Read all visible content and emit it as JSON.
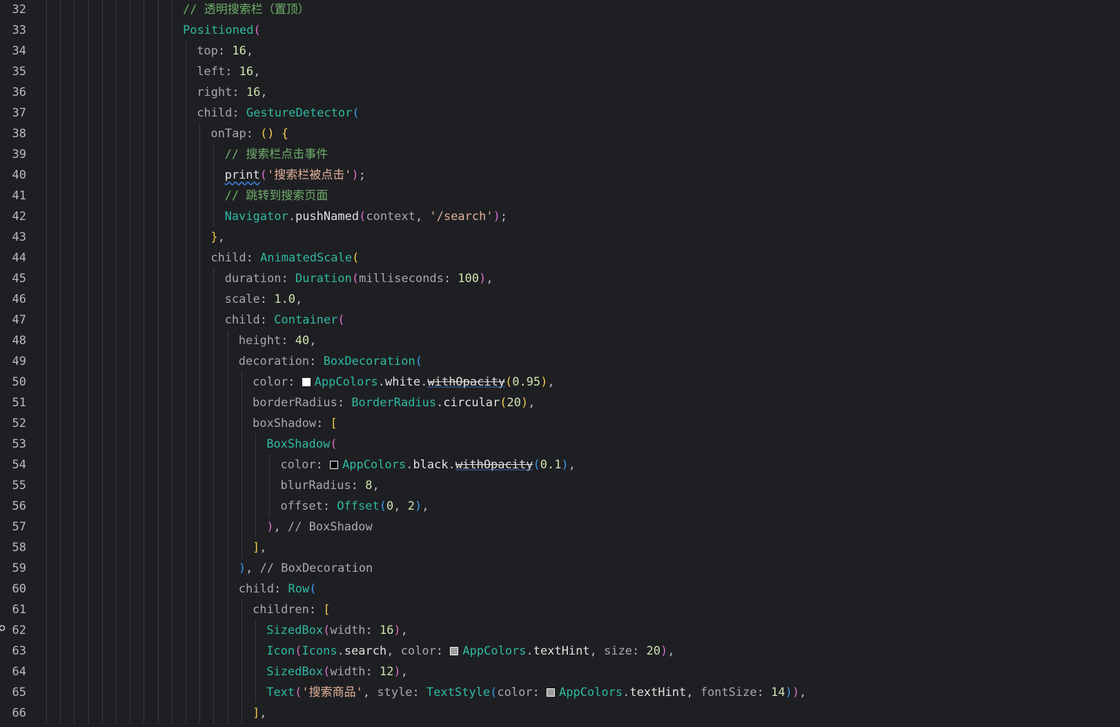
{
  "editor": {
    "language": "dart",
    "colors": {
      "background": "#1e1f22",
      "line_number": "#b9bcc2",
      "class": "#2fbaa3",
      "comment": "#6fae6b",
      "string": "#e3b09a",
      "number": "#cfe3b0",
      "swatch_white": "#ffffff",
      "swatch_black": "#000000",
      "swatch_hint": "#9e9e9e"
    },
    "gutter_icon": "search-usage-icon",
    "lines": [
      {
        "n": "32",
        "indent": 10,
        "tokens": [
          {
            "t": "// 透明搜索栏（置顶）",
            "c": "comment"
          }
        ]
      },
      {
        "n": "33",
        "indent": 10,
        "tokens": [
          {
            "t": "Positioned",
            "c": "cls"
          },
          {
            "t": "(",
            "c": "b2"
          }
        ]
      },
      {
        "n": "34",
        "indent": 11,
        "tokens": [
          {
            "t": "top",
            "c": "param"
          },
          {
            "t": ": ",
            "c": "punct"
          },
          {
            "t": "16",
            "c": "num"
          },
          {
            "t": ",",
            "c": "punct"
          }
        ]
      },
      {
        "n": "35",
        "indent": 11,
        "tokens": [
          {
            "t": "left",
            "c": "param"
          },
          {
            "t": ": ",
            "c": "punct"
          },
          {
            "t": "16",
            "c": "num"
          },
          {
            "t": ",",
            "c": "punct"
          }
        ]
      },
      {
        "n": "36",
        "indent": 11,
        "tokens": [
          {
            "t": "right",
            "c": "param"
          },
          {
            "t": ": ",
            "c": "punct"
          },
          {
            "t": "16",
            "c": "num"
          },
          {
            "t": ",",
            "c": "punct"
          }
        ]
      },
      {
        "n": "37",
        "indent": 11,
        "tokens": [
          {
            "t": "child",
            "c": "param"
          },
          {
            "t": ": ",
            "c": "punct"
          },
          {
            "t": "GestureDetector",
            "c": "cls"
          },
          {
            "t": "(",
            "c": "b3"
          }
        ]
      },
      {
        "n": "38",
        "indent": 12,
        "tokens": [
          {
            "t": "onTap",
            "c": "param"
          },
          {
            "t": ": ",
            "c": "punct"
          },
          {
            "t": "()",
            "c": "b1"
          },
          {
            "t": " ",
            "c": "punct"
          },
          {
            "t": "{",
            "c": "b1"
          }
        ]
      },
      {
        "n": "39",
        "indent": 13,
        "tokens": [
          {
            "t": "// 搜索栏点击事件",
            "c": "comment"
          }
        ]
      },
      {
        "n": "40",
        "indent": 13,
        "tokens": [
          {
            "t": "print",
            "c": "fn",
            "deco": "wavy"
          },
          {
            "t": "(",
            "c": "b2"
          },
          {
            "t": "'搜索栏被点击'",
            "c": "str"
          },
          {
            "t": ")",
            "c": "b2"
          },
          {
            "t": ";",
            "c": "punct"
          }
        ]
      },
      {
        "n": "41",
        "indent": 13,
        "tokens": [
          {
            "t": "// 跳转到搜索页面",
            "c": "comment"
          }
        ]
      },
      {
        "n": "42",
        "indent": 13,
        "tokens": [
          {
            "t": "Navigator",
            "c": "cls"
          },
          {
            "t": ".",
            "c": "punct"
          },
          {
            "t": "pushNamed",
            "c": "fn"
          },
          {
            "t": "(",
            "c": "b2"
          },
          {
            "t": "context",
            "c": "param"
          },
          {
            "t": ", ",
            "c": "punct"
          },
          {
            "t": "'/search'",
            "c": "str"
          },
          {
            "t": ")",
            "c": "b2"
          },
          {
            "t": ";",
            "c": "punct"
          }
        ]
      },
      {
        "n": "43",
        "indent": 12,
        "tokens": [
          {
            "t": "}",
            "c": "b1"
          },
          {
            "t": ",",
            "c": "punct"
          }
        ]
      },
      {
        "n": "44",
        "indent": 12,
        "tokens": [
          {
            "t": "child",
            "c": "param"
          },
          {
            "t": ": ",
            "c": "punct"
          },
          {
            "t": "AnimatedScale",
            "c": "cls"
          },
          {
            "t": "(",
            "c": "b1"
          }
        ]
      },
      {
        "n": "45",
        "indent": 13,
        "tokens": [
          {
            "t": "duration",
            "c": "param"
          },
          {
            "t": ": ",
            "c": "punct"
          },
          {
            "t": "Duration",
            "c": "cls"
          },
          {
            "t": "(",
            "c": "b2"
          },
          {
            "t": "milliseconds",
            "c": "param"
          },
          {
            "t": ": ",
            "c": "punct"
          },
          {
            "t": "100",
            "c": "num"
          },
          {
            "t": ")",
            "c": "b2"
          },
          {
            "t": ",",
            "c": "punct"
          }
        ]
      },
      {
        "n": "46",
        "indent": 13,
        "tokens": [
          {
            "t": "scale",
            "c": "param"
          },
          {
            "t": ": ",
            "c": "punct"
          },
          {
            "t": "1.0",
            "c": "num"
          },
          {
            "t": ",",
            "c": "punct"
          }
        ]
      },
      {
        "n": "47",
        "indent": 13,
        "tokens": [
          {
            "t": "child",
            "c": "param"
          },
          {
            "t": ": ",
            "c": "punct"
          },
          {
            "t": "Container",
            "c": "cls"
          },
          {
            "t": "(",
            "c": "b2"
          }
        ]
      },
      {
        "n": "48",
        "indent": 14,
        "tokens": [
          {
            "t": "height",
            "c": "param"
          },
          {
            "t": ": ",
            "c": "punct"
          },
          {
            "t": "40",
            "c": "num"
          },
          {
            "t": ",",
            "c": "punct"
          }
        ]
      },
      {
        "n": "49",
        "indent": 14,
        "tokens": [
          {
            "t": "decoration",
            "c": "param"
          },
          {
            "t": ": ",
            "c": "punct"
          },
          {
            "t": "BoxDecoration",
            "c": "cls"
          },
          {
            "t": "(",
            "c": "b3"
          }
        ]
      },
      {
        "n": "50",
        "indent": 15,
        "tokens": [
          {
            "t": "color",
            "c": "param"
          },
          {
            "t": ": ",
            "c": "punct"
          },
          {
            "swatch": "#ffffff"
          },
          {
            "t": "AppColors",
            "c": "cls"
          },
          {
            "t": ".",
            "c": "punct"
          },
          {
            "t": "white",
            "c": "fn"
          },
          {
            "t": ".",
            "c": "punct"
          },
          {
            "t": "withOpacity",
            "c": "fn",
            "deco": "strike-wavy"
          },
          {
            "t": "(",
            "c": "b1"
          },
          {
            "t": "0.95",
            "c": "num"
          },
          {
            "t": ")",
            "c": "b1"
          },
          {
            "t": ",",
            "c": "punct"
          }
        ]
      },
      {
        "n": "51",
        "indent": 15,
        "tokens": [
          {
            "t": "borderRadius",
            "c": "param"
          },
          {
            "t": ": ",
            "c": "punct"
          },
          {
            "t": "BorderRadius",
            "c": "cls"
          },
          {
            "t": ".",
            "c": "punct"
          },
          {
            "t": "circular",
            "c": "fn"
          },
          {
            "t": "(",
            "c": "b1"
          },
          {
            "t": "20",
            "c": "num"
          },
          {
            "t": ")",
            "c": "b1"
          },
          {
            "t": ",",
            "c": "punct"
          }
        ]
      },
      {
        "n": "52",
        "indent": 15,
        "tokens": [
          {
            "t": "boxShadow",
            "c": "param"
          },
          {
            "t": ": ",
            "c": "punct"
          },
          {
            "t": "[",
            "c": "b1"
          }
        ]
      },
      {
        "n": "53",
        "indent": 16,
        "tokens": [
          {
            "t": "BoxShadow",
            "c": "cls"
          },
          {
            "t": "(",
            "c": "b2"
          }
        ]
      },
      {
        "n": "54",
        "indent": 17,
        "tokens": [
          {
            "t": "color",
            "c": "param"
          },
          {
            "t": ": ",
            "c": "punct"
          },
          {
            "swatch": "#000000"
          },
          {
            "t": "AppColors",
            "c": "cls"
          },
          {
            "t": ".",
            "c": "punct"
          },
          {
            "t": "black",
            "c": "fn"
          },
          {
            "t": ".",
            "c": "punct"
          },
          {
            "t": "withOpacity",
            "c": "fn",
            "deco": "strike-wavy"
          },
          {
            "t": "(",
            "c": "b3"
          },
          {
            "t": "0.1",
            "c": "num"
          },
          {
            "t": ")",
            "c": "b3"
          },
          {
            "t": ",",
            "c": "punct"
          }
        ]
      },
      {
        "n": "55",
        "indent": 17,
        "tokens": [
          {
            "t": "blurRadius",
            "c": "param"
          },
          {
            "t": ": ",
            "c": "punct"
          },
          {
            "t": "8",
            "c": "num"
          },
          {
            "t": ",",
            "c": "punct"
          }
        ]
      },
      {
        "n": "56",
        "indent": 17,
        "tokens": [
          {
            "t": "offset",
            "c": "param"
          },
          {
            "t": ": ",
            "c": "punct"
          },
          {
            "t": "Offset",
            "c": "cls"
          },
          {
            "t": "(",
            "c": "b3"
          },
          {
            "t": "0",
            "c": "num"
          },
          {
            "t": ", ",
            "c": "punct"
          },
          {
            "t": "2",
            "c": "num"
          },
          {
            "t": ")",
            "c": "b3"
          },
          {
            "t": ",",
            "c": "punct"
          }
        ]
      },
      {
        "n": "57",
        "indent": 16,
        "tokens": [
          {
            "t": ")",
            "c": "b2"
          },
          {
            "t": ", ",
            "c": "punct"
          },
          {
            "t": "// BoxShadow",
            "c": "comment-plain"
          }
        ]
      },
      {
        "n": "58",
        "indent": 15,
        "tokens": [
          {
            "t": "]",
            "c": "b1"
          },
          {
            "t": ",",
            "c": "punct"
          }
        ]
      },
      {
        "n": "59",
        "indent": 14,
        "tokens": [
          {
            "t": ")",
            "c": "b3"
          },
          {
            "t": ", ",
            "c": "punct"
          },
          {
            "t": "// BoxDecoration",
            "c": "comment-plain"
          }
        ]
      },
      {
        "n": "60",
        "indent": 14,
        "tokens": [
          {
            "t": "child",
            "c": "param"
          },
          {
            "t": ": ",
            "c": "punct"
          },
          {
            "t": "Row",
            "c": "cls"
          },
          {
            "t": "(",
            "c": "b3"
          }
        ]
      },
      {
        "n": "61",
        "indent": 15,
        "tokens": [
          {
            "t": "children",
            "c": "param"
          },
          {
            "t": ": ",
            "c": "punct"
          },
          {
            "t": "[",
            "c": "b1"
          }
        ]
      },
      {
        "n": "62",
        "indent": 16,
        "tokens": [
          {
            "t": "SizedBox",
            "c": "cls"
          },
          {
            "t": "(",
            "c": "b2"
          },
          {
            "t": "width",
            "c": "param"
          },
          {
            "t": ": ",
            "c": "punct"
          },
          {
            "t": "16",
            "c": "num"
          },
          {
            "t": ")",
            "c": "b2"
          },
          {
            "t": ",",
            "c": "punct"
          }
        ]
      },
      {
        "n": "63",
        "indent": 16,
        "tokens": [
          {
            "t": "Icon",
            "c": "cls"
          },
          {
            "t": "(",
            "c": "b2"
          },
          {
            "t": "Icons",
            "c": "cls"
          },
          {
            "t": ".",
            "c": "punct"
          },
          {
            "t": "search",
            "c": "fn"
          },
          {
            "t": ", ",
            "c": "punct"
          },
          {
            "t": "color",
            "c": "param"
          },
          {
            "t": ": ",
            "c": "punct"
          },
          {
            "swatch": "#9e9e9e"
          },
          {
            "t": "AppColors",
            "c": "cls"
          },
          {
            "t": ".",
            "c": "punct"
          },
          {
            "t": "textHint",
            "c": "fn"
          },
          {
            "t": ", ",
            "c": "punct"
          },
          {
            "t": "size",
            "c": "param"
          },
          {
            "t": ": ",
            "c": "punct"
          },
          {
            "t": "20",
            "c": "num"
          },
          {
            "t": ")",
            "c": "b2"
          },
          {
            "t": ",",
            "c": "punct"
          }
        ]
      },
      {
        "n": "64",
        "indent": 16,
        "tokens": [
          {
            "t": "SizedBox",
            "c": "cls"
          },
          {
            "t": "(",
            "c": "b2"
          },
          {
            "t": "width",
            "c": "param"
          },
          {
            "t": ": ",
            "c": "punct"
          },
          {
            "t": "12",
            "c": "num"
          },
          {
            "t": ")",
            "c": "b2"
          },
          {
            "t": ",",
            "c": "punct"
          }
        ]
      },
      {
        "n": "65",
        "indent": 16,
        "tokens": [
          {
            "t": "Text",
            "c": "cls"
          },
          {
            "t": "(",
            "c": "b2"
          },
          {
            "t": "'搜索商品'",
            "c": "str"
          },
          {
            "t": ", ",
            "c": "punct"
          },
          {
            "t": "style",
            "c": "param"
          },
          {
            "t": ": ",
            "c": "punct"
          },
          {
            "t": "TextStyle",
            "c": "cls"
          },
          {
            "t": "(",
            "c": "b3"
          },
          {
            "t": "color",
            "c": "param"
          },
          {
            "t": ": ",
            "c": "punct"
          },
          {
            "swatch": "#9e9e9e"
          },
          {
            "t": "AppColors",
            "c": "cls"
          },
          {
            "t": ".",
            "c": "punct"
          },
          {
            "t": "textHint",
            "c": "fn"
          },
          {
            "t": ", ",
            "c": "punct"
          },
          {
            "t": "fontSize",
            "c": "param"
          },
          {
            "t": ": ",
            "c": "punct"
          },
          {
            "t": "14",
            "c": "num"
          },
          {
            "t": ")",
            "c": "b3"
          },
          {
            "t": ")",
            "c": "b2"
          },
          {
            "t": ",",
            "c": "punct"
          }
        ]
      },
      {
        "n": "66",
        "indent": 15,
        "tokens": [
          {
            "t": "]",
            "c": "b1"
          },
          {
            "t": ",",
            "c": "punct"
          }
        ]
      }
    ]
  }
}
